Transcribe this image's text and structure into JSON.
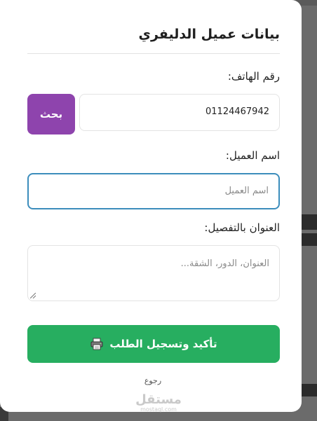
{
  "modal": {
    "title": "بيانات عميل الدليفري"
  },
  "phone": {
    "label": "رقم الهاتف:",
    "value": "01124467942"
  },
  "search_button": {
    "label": "بحث"
  },
  "customer_name": {
    "label": "اسم العميل:",
    "placeholder": "اسم العميل"
  },
  "address": {
    "label": "العنوان بالتفصيل:",
    "placeholder": "العنوان، الدور، الشقة..."
  },
  "confirm_button": {
    "label": "تأكيد وتسجيل الطلب",
    "icon": "printer-icon"
  },
  "back_link": {
    "label": "رجوع"
  },
  "watermark": {
    "arabic": "مستقل",
    "latin": "mostaql.com"
  },
  "colors": {
    "search_button": "#8e44ad",
    "confirm_button": "#27ae60",
    "focused_border": "#3c8dbc"
  }
}
